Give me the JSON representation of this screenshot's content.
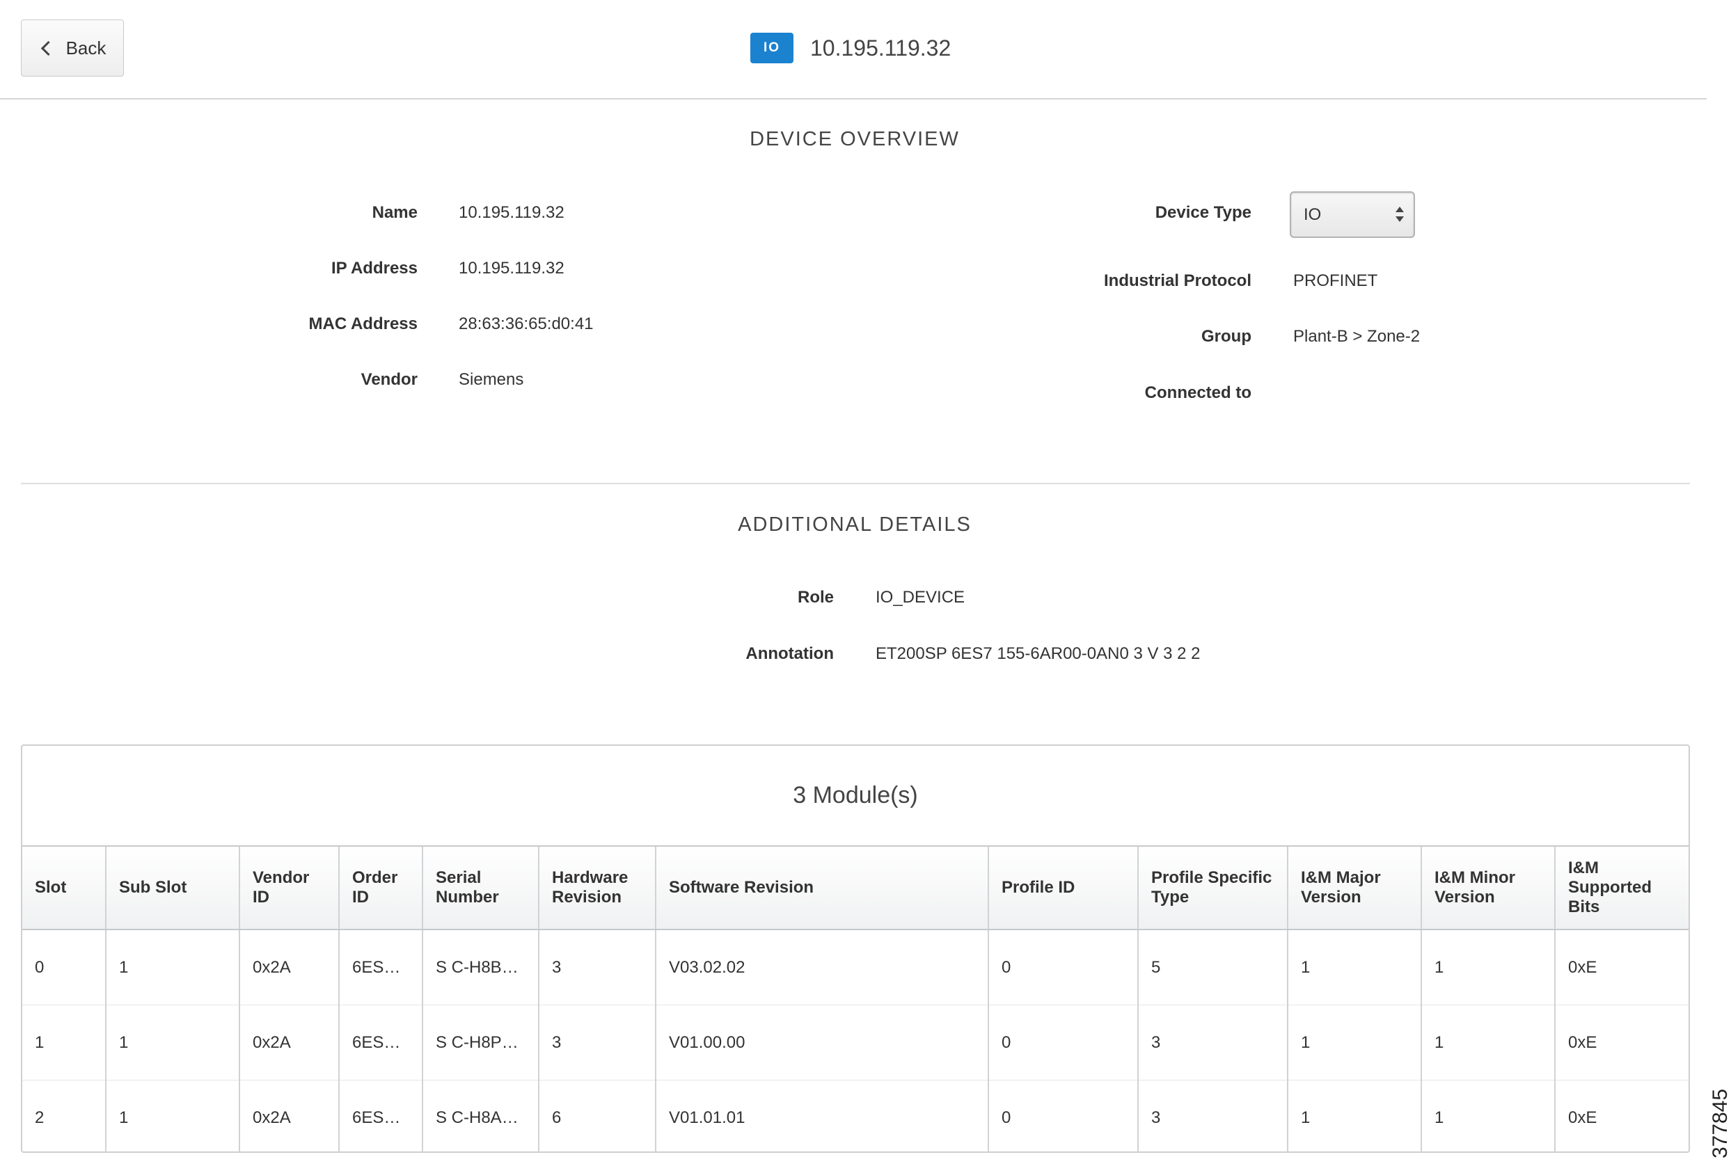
{
  "header": {
    "back_label": "Back",
    "badge": "IO",
    "title": "10.195.119.32"
  },
  "overview": {
    "title": "DEVICE OVERVIEW",
    "left": [
      {
        "label": "Name",
        "value": "10.195.119.32"
      },
      {
        "label": "IP Address",
        "value": "10.195.119.32"
      },
      {
        "label": "MAC Address",
        "value": "28:63:36:65:d0:41"
      },
      {
        "label": "Vendor",
        "value": "Siemens"
      }
    ],
    "device_type": {
      "label": "Device Type",
      "selected": "IO"
    },
    "right": [
      {
        "label": "Industrial Protocol",
        "value": "PROFINET"
      },
      {
        "label": "Group",
        "value": "Plant-B > Zone-2"
      },
      {
        "label": "Connected to",
        "value": ""
      }
    ]
  },
  "additional": {
    "title": "ADDITIONAL DETAILS",
    "fields": [
      {
        "label": "Role",
        "value": "IO_DEVICE"
      },
      {
        "label": "Annotation",
        "value": "ET200SP 6ES7 155-6AR00-0AN0 3 V 3 2 2"
      }
    ]
  },
  "modules": {
    "caption": "3 Module(s)",
    "headers": [
      "Slot",
      "Sub Slot",
      "Vendor ID",
      "Order ID",
      "Serial Number",
      "Hardware Revision",
      "Software Revision",
      "Profile ID",
      "Profile Specific Type",
      "I&M Major Version",
      "I&M Minor Version",
      "I&M Supported Bits"
    ],
    "rows": [
      [
        "0",
        "1",
        "0x2A",
        "6ES…",
        "S C-H8B…",
        "3",
        "V03.02.02",
        "0",
        "5",
        "1",
        "1",
        "0xE"
      ],
      [
        "1",
        "1",
        "0x2A",
        "6ES…",
        "S C-H8P…",
        "3",
        "V01.00.00",
        "0",
        "3",
        "1",
        "1",
        "0xE"
      ],
      [
        "2",
        "1",
        "0x2A",
        "6ES…",
        "S C-H8A…",
        "6",
        "V01.01.01",
        "0",
        "3",
        "1",
        "1",
        "0xE"
      ]
    ]
  },
  "figure_id": "377845",
  "colors": {
    "badge": "#1b82cf"
  }
}
